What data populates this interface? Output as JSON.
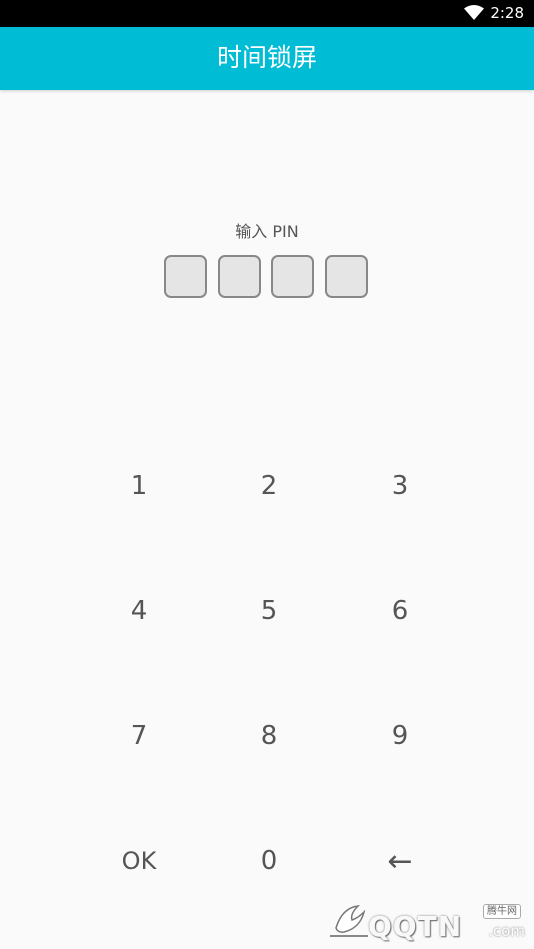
{
  "status_bar": {
    "time": "2:28",
    "wifi_icon": "wifi-full-icon"
  },
  "app_bar": {
    "title": "时间锁屏"
  },
  "pin": {
    "label": "输入 PIN",
    "digits_entered": 0,
    "digit_count": 4
  },
  "keypad": {
    "keys": [
      "1",
      "2",
      "3",
      "4",
      "5",
      "6",
      "7",
      "8",
      "9",
      "OK",
      "0",
      "←"
    ]
  },
  "watermark": {
    "text": "QQTN",
    "suffix": ".com",
    "badge": "腾牛网"
  },
  "colors": {
    "app_bar": "#00bcd4",
    "background": "#fafafa",
    "key_text": "#555555",
    "pin_box_fill": "#e5e5e5",
    "pin_box_border": "#888888"
  }
}
